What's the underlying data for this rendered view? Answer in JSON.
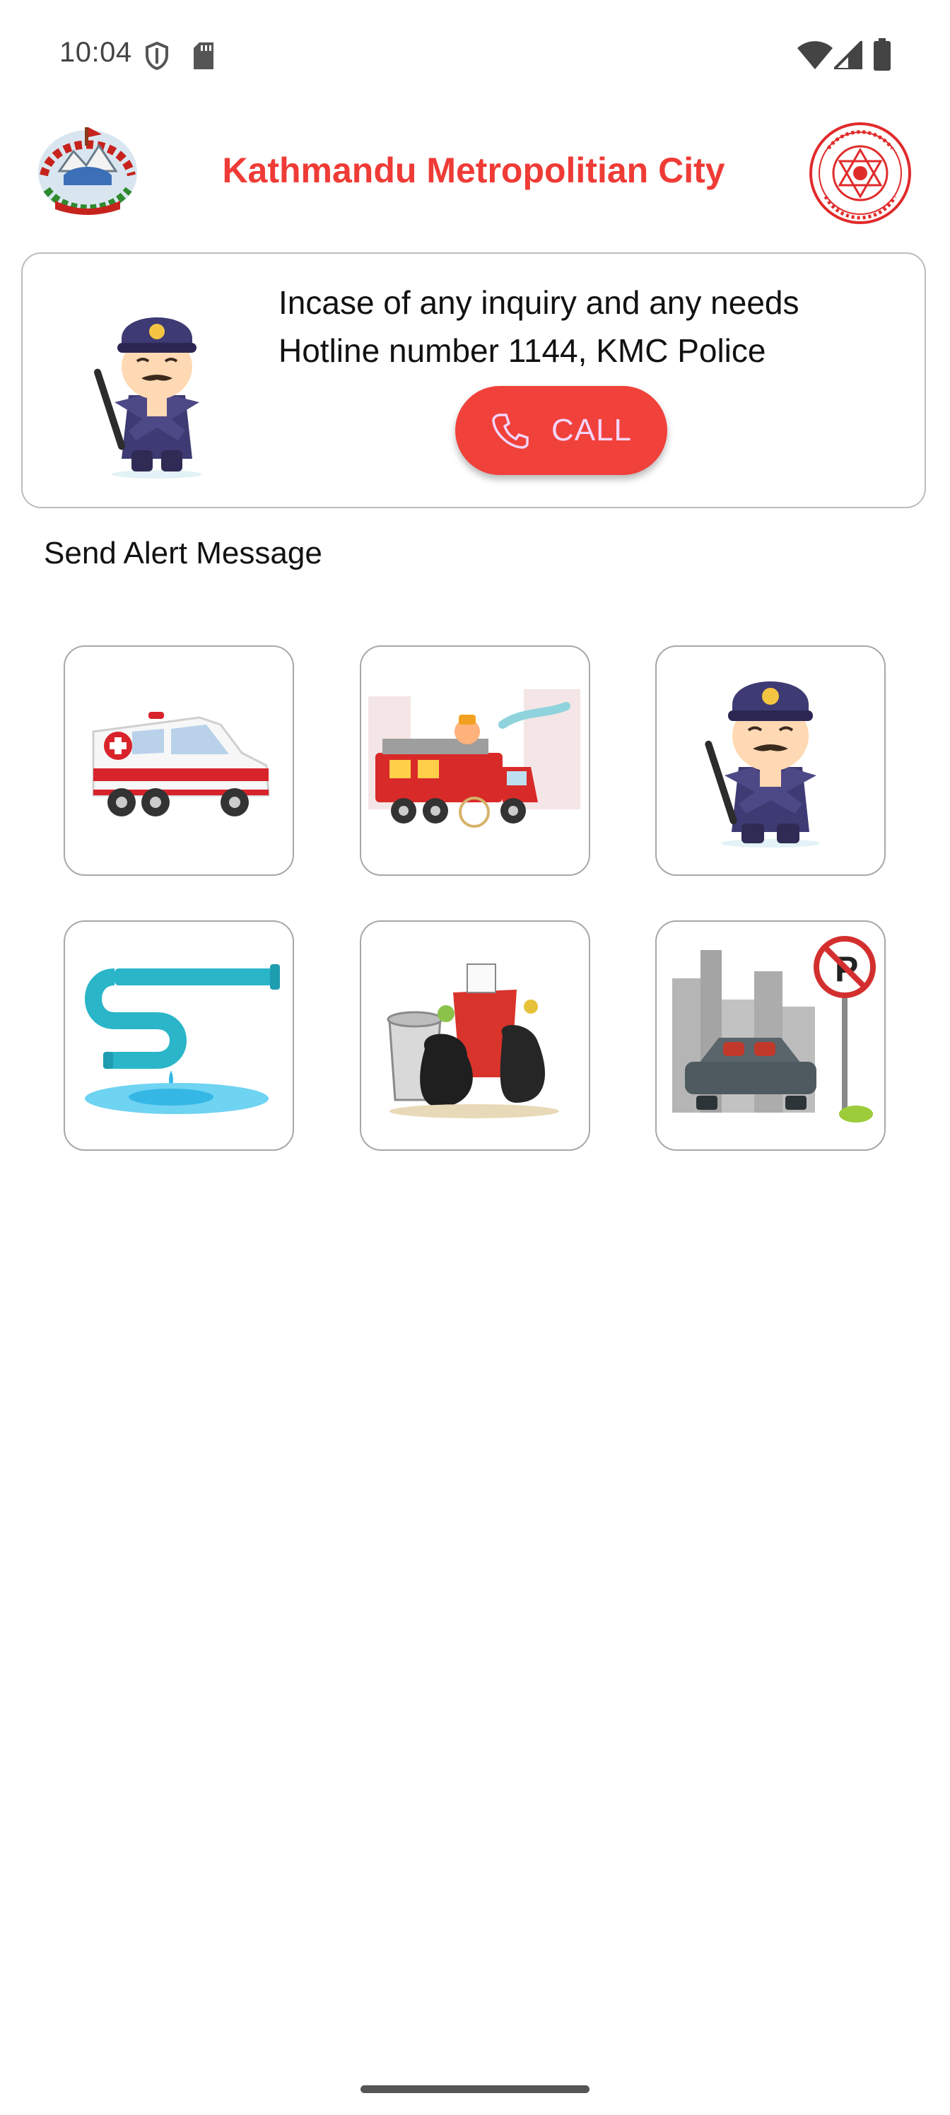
{
  "status_bar": {
    "time": "10:04",
    "icons": [
      "shield-icon",
      "sd-card-icon",
      "wifi-icon",
      "cellular-signal-icon",
      "battery-icon"
    ]
  },
  "header": {
    "title": "Kathmandu Metropolitian City",
    "left_logo": "nepal-emblem-logo",
    "right_logo": "kmc-seal-logo"
  },
  "hotline": {
    "line1": "Incase of any inquiry and any needs",
    "line2": "Hotline number 1144, KMC Police",
    "call_label": "CALL",
    "call_icon": "phone-icon"
  },
  "alerts": {
    "section_title": "Send Alert Message",
    "items": [
      {
        "icon": "ambulance-icon"
      },
      {
        "icon": "fire-truck-icon"
      },
      {
        "icon": "police-officer-icon"
      },
      {
        "icon": "water-leak-pipe-icon"
      },
      {
        "icon": "garbage-icon"
      },
      {
        "icon": "no-parking-car-icon"
      }
    ]
  },
  "colors": {
    "brand_red": "#ef3b36",
    "call_button": "#f1413b",
    "call_label": "#f2d6ff",
    "police_uniform": "#3e3a73",
    "tile_border": "#a8a8a8"
  }
}
